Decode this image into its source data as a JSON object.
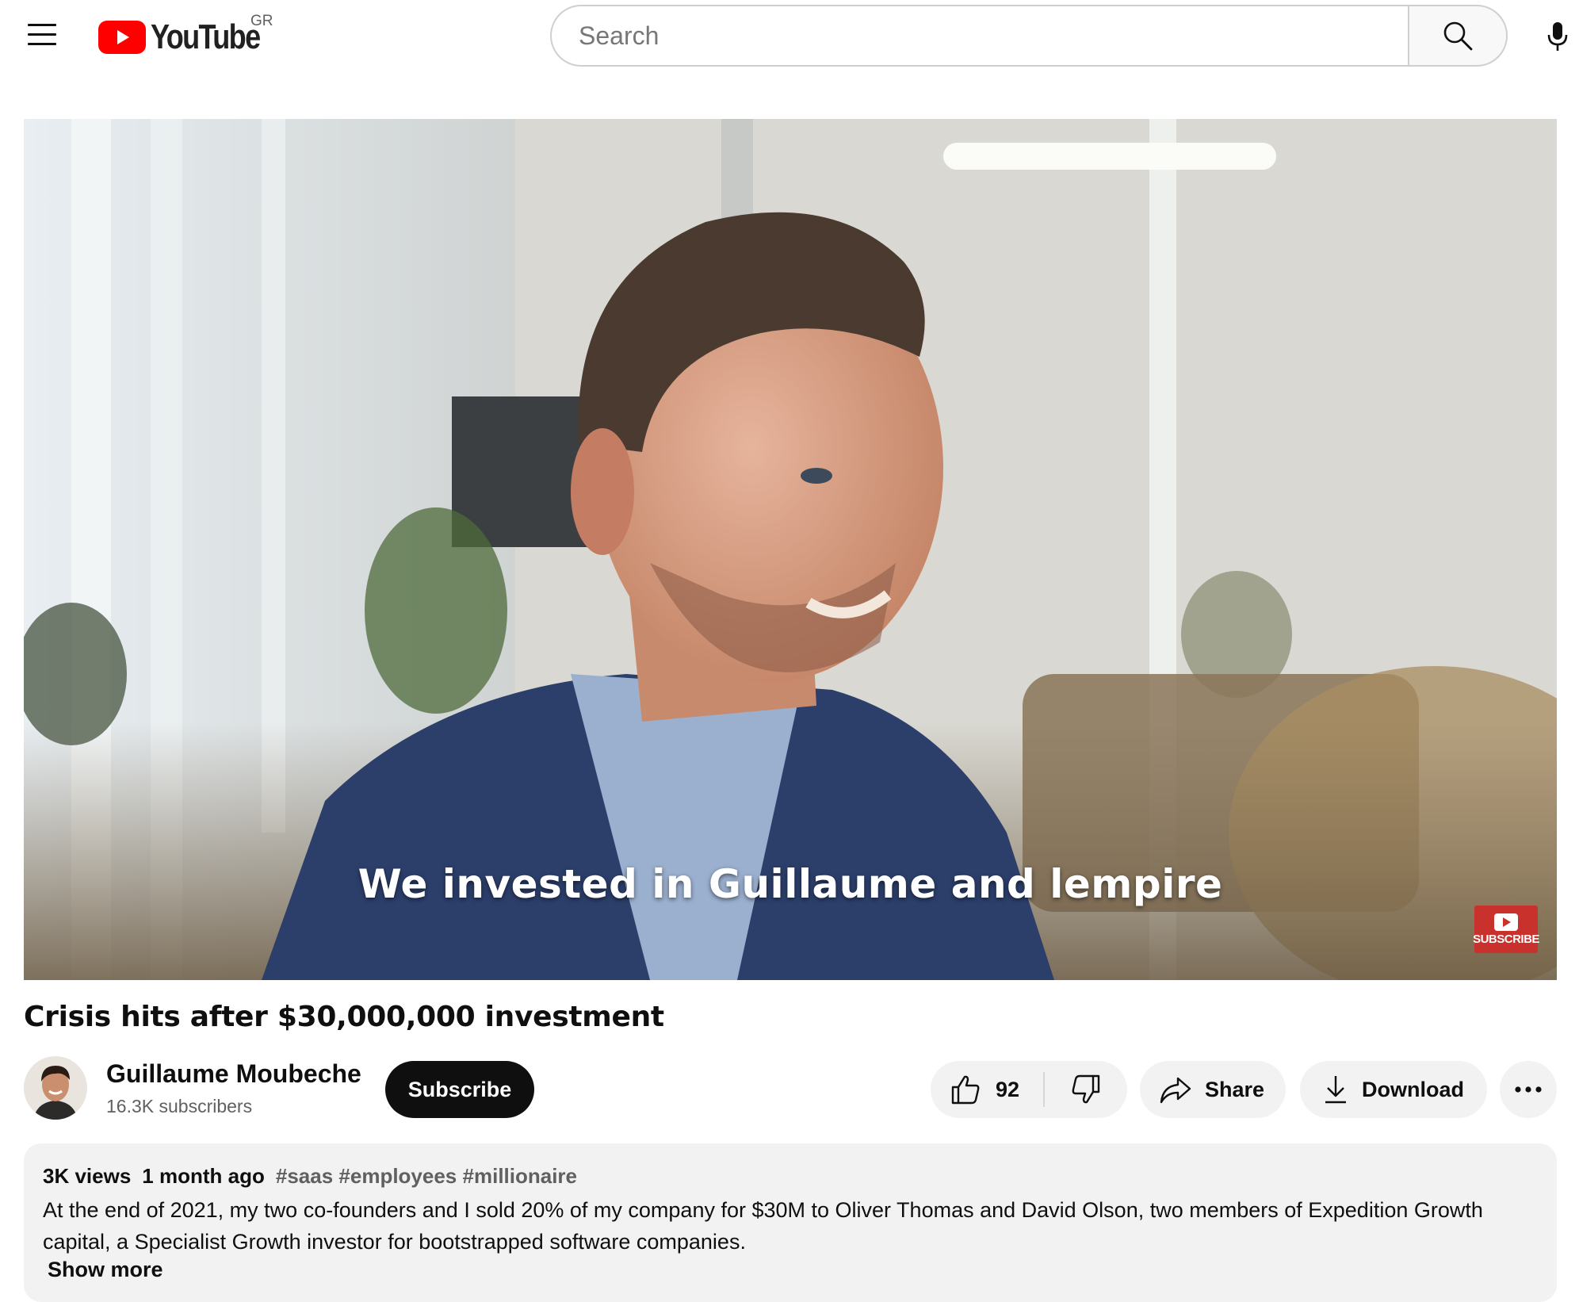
{
  "masthead": {
    "logo_text": "YouTube",
    "country_code": "GR",
    "search_placeholder": "Search",
    "icons": [
      "menu-icon",
      "youtube-logo-icon",
      "search-icon",
      "microphone-icon"
    ]
  },
  "player": {
    "caption": "We invested in Guillaume and lempire",
    "watermark_label": "SUBSCRIBE"
  },
  "video": {
    "title": "Crisis hits after $30,000,000 investment"
  },
  "owner": {
    "channel_name": "Guillaume Moubeche",
    "subscribers": "16.3K subscribers",
    "subscribe_label": "Subscribe"
  },
  "actions": {
    "like_count": "92",
    "share_label": "Share",
    "download_label": "Download",
    "icons": [
      "thumbs-up-icon",
      "thumbs-down-icon",
      "share-icon",
      "download-icon",
      "more-icon"
    ]
  },
  "description": {
    "views": "3K views",
    "date": "1 month ago",
    "hashtags": [
      "#saas",
      "#employees",
      "#millionaire"
    ],
    "text": "At the end of 2021, my two co-founders and I sold 20% of my company for $30M to Oliver Thomas and David Olson, two members of Expedition Growth capital, a Specialist Growth investor for bootstrapped software companies.",
    "show_more": "Show more"
  },
  "colors": {
    "brand_red": "#ff0000",
    "text_primary": "#0f0f0f",
    "text_secondary": "#606060",
    "pill_background": "#f2f2f2",
    "subscribe_background": "#0f0f0f"
  }
}
